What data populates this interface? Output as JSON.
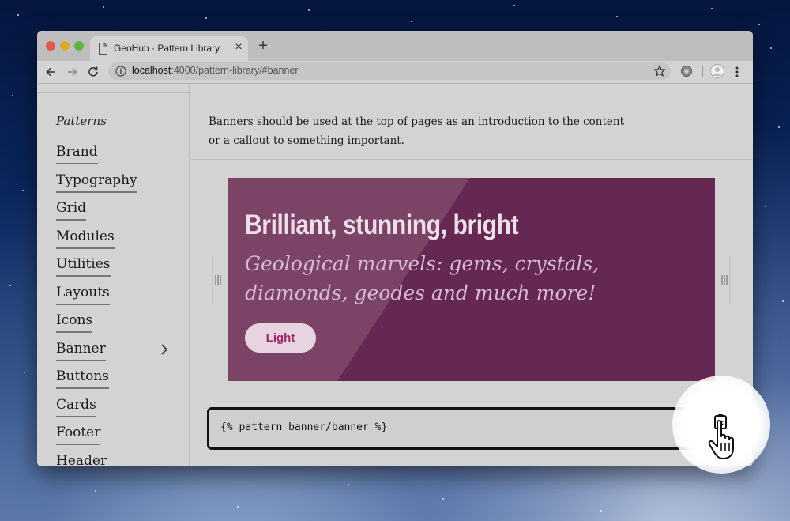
{
  "browser": {
    "tab_title": "GeoHub · Pattern Library",
    "new_tab": "+",
    "close": "×",
    "url_host": "localhost",
    "url_rest": ":4000/pattern-library/#banner"
  },
  "sidebar": {
    "heading": "Patterns",
    "items": [
      {
        "label": "Brand"
      },
      {
        "label": "Typography"
      },
      {
        "label": "Grid"
      },
      {
        "label": "Modules"
      },
      {
        "label": "Utilities"
      },
      {
        "label": "Layouts"
      },
      {
        "label": "Icons"
      },
      {
        "label": "Banner"
      },
      {
        "label": "Buttons"
      },
      {
        "label": "Cards"
      },
      {
        "label": "Footer"
      },
      {
        "label": "Header"
      }
    ]
  },
  "main": {
    "intro": "Banners should be used at the top of pages as an introduction to the content or a callout to something important.",
    "banner": {
      "title": "Brilliant, stunning, bright",
      "subtitle": "Geological marvels: gems, crystals, diamonds, geodes and much more!",
      "button_label": "Light",
      "bg_color": "#652852",
      "accent_color": "#a1246c"
    },
    "code_snippet": "{% pattern banner/banner %}"
  },
  "icons": {
    "document": "document-icon",
    "back": "back-arrow-icon",
    "forward": "forward-arrow-icon",
    "reload": "reload-icon",
    "info": "info-icon",
    "bookmark": "star-icon",
    "extension": "extension-icon",
    "profile": "profile-icon",
    "menu": "kebab-menu-icon",
    "chevron": "chevron-right-icon",
    "drag_handle": "drag-handle-icon",
    "clipboard": "clipboard-icon",
    "cursor": "hand-cursor-icon"
  }
}
